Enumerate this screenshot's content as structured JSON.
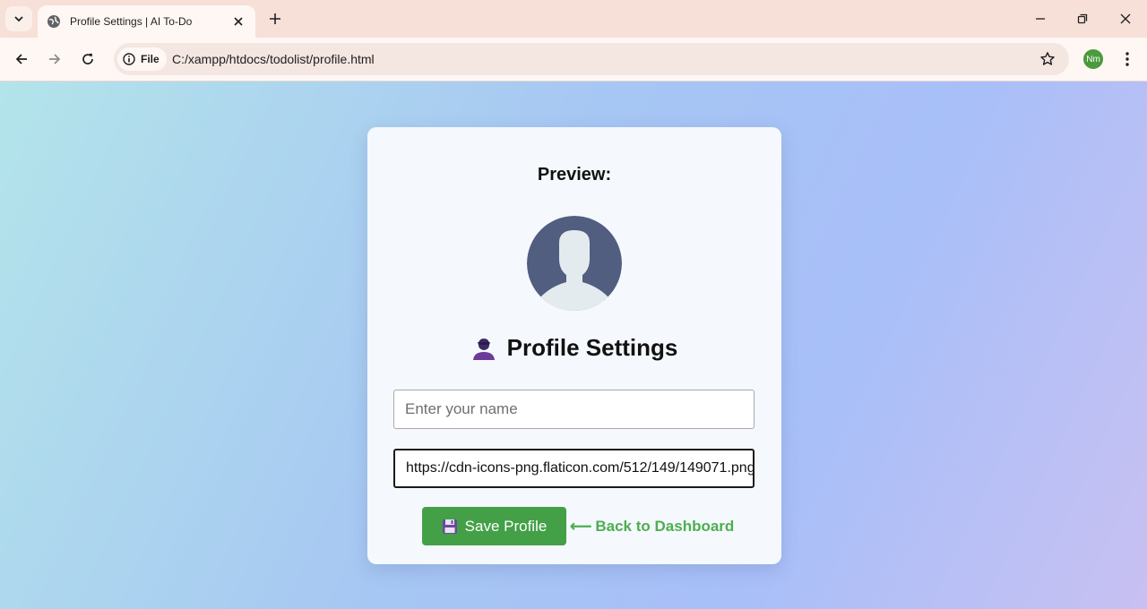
{
  "browser": {
    "tab_title": "Profile Settings | AI To-Do",
    "security_chip_label": "File",
    "url": "C:/xampp/htdocs/todolist/profile.html",
    "profile_initials": "Nm"
  },
  "page": {
    "preview_label": "Preview:",
    "settings_title": "Profile Settings",
    "name_input": {
      "placeholder": "Enter your name",
      "value": ""
    },
    "avatar_url_input": {
      "value": "https://cdn-icons-png.flaticon.com/512/149/149071.png"
    },
    "save_button_label": "Save Profile",
    "back_link_label": "Back to Dashboard",
    "back_link_arrow": "⟵"
  },
  "colors": {
    "save_button": "#43a047",
    "back_link": "#4caf50",
    "profile_avatar_bg": "#525e80"
  }
}
